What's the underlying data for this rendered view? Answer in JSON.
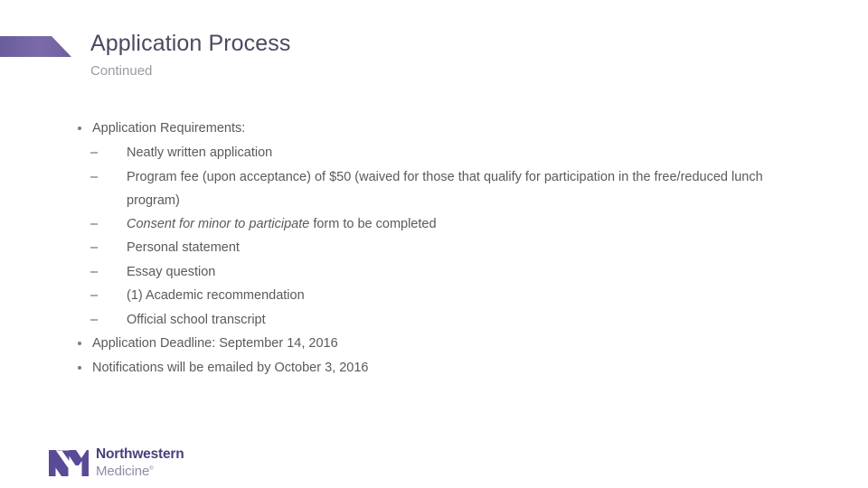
{
  "slide": {
    "title": "Application Process",
    "subtitle": "Continued",
    "accent_color": "#6f5fa0",
    "title_color": "#4e4860",
    "subtitle_color": "#9a9aa3",
    "body_color": "#5a5a5a"
  },
  "content": {
    "bullets": [
      {
        "level": 1,
        "marker": "dot",
        "text": "Application Requirements:"
      },
      {
        "level": 2,
        "marker": "–",
        "text": "Neatly written application"
      },
      {
        "level": 2,
        "marker": "–",
        "text": "Program fee (upon acceptance) of $50 (waived for those that qualify for participation in the free/reduced lunch program)"
      },
      {
        "level": 2,
        "marker": "–",
        "italic_prefix": "Consent for minor to participate",
        "text": " form to be completed"
      },
      {
        "level": 2,
        "marker": "–",
        "text": "Personal statement"
      },
      {
        "level": 2,
        "marker": "–",
        "text": "Essay question"
      },
      {
        "level": 2,
        "marker": "–",
        "text": "(1) Academic recommendation"
      },
      {
        "level": 2,
        "marker": "–",
        "text": "Official school transcript"
      },
      {
        "level": 1,
        "marker": "dot",
        "text": "Application Deadline: September 14, 2016"
      },
      {
        "level": 1,
        "marker": "dot",
        "text": "Notifications will be emailed by October 3, 2016"
      }
    ]
  },
  "logo": {
    "mark_alt": "northwestern-medicine-nm-monogram",
    "word_top": "Northwestern",
    "word_bottom": "Medicine",
    "registered_mark": "®",
    "mark_color": "#5b4a96",
    "word_top_color": "#4b3f7a",
    "word_bottom_color": "#8f8ca3"
  }
}
